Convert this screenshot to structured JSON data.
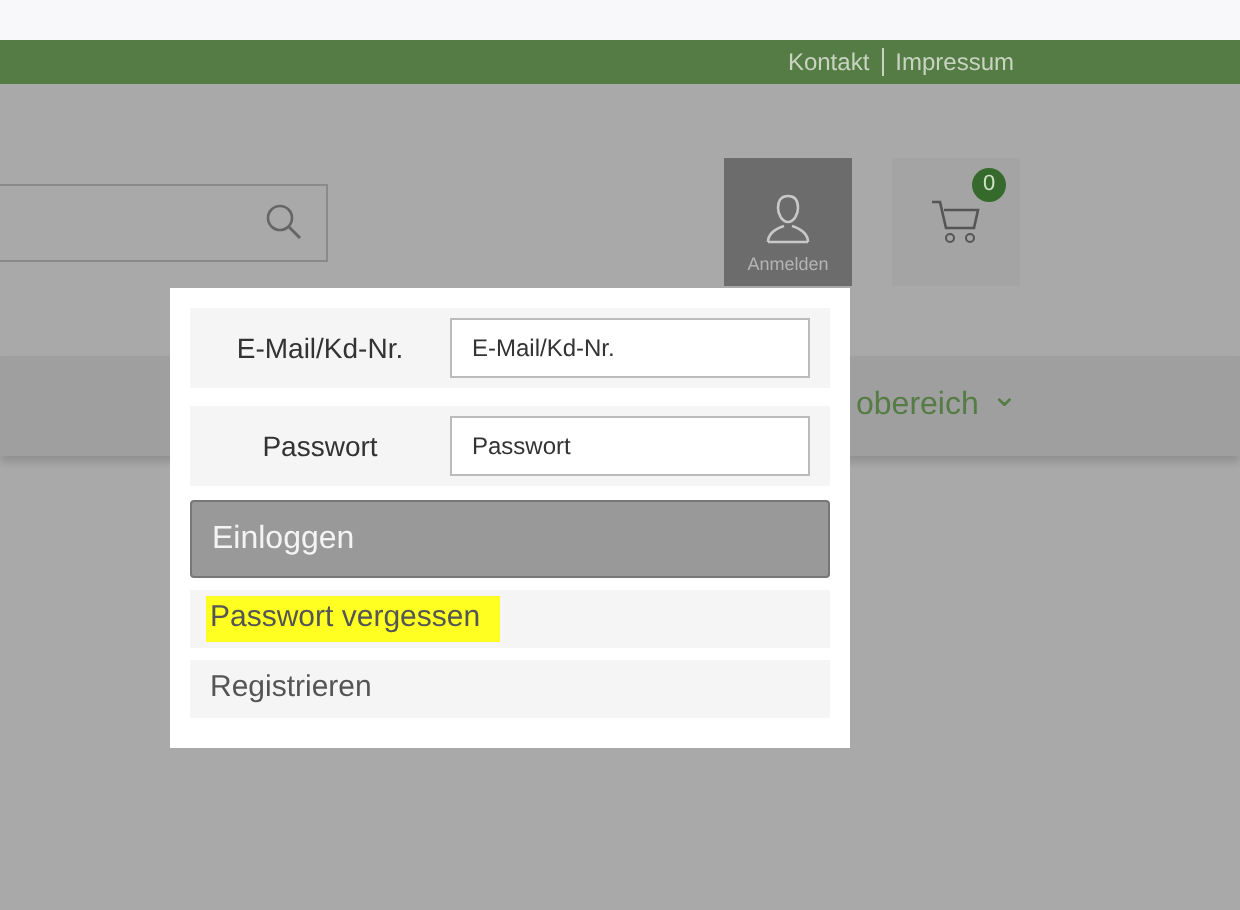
{
  "top_links": [
    "Kontakt",
    "Impressum"
  ],
  "account": {
    "label": "Anmelden",
    "active": true
  },
  "cart": {
    "count": "0"
  },
  "nav": {
    "item": "obereich",
    "chevron": "⌄"
  },
  "login": {
    "fields": [
      {
        "label": "E-Mail/Kd-Nr.",
        "placeholder": "E-Mail/Kd-Nr."
      },
      {
        "label": "Passwort",
        "placeholder": "Passwort"
      }
    ],
    "submit": "Einloggen",
    "links": [
      {
        "text": "Passwort vergessen",
        "highlighted": true
      },
      {
        "text": "Registrieren",
        "highlighted": false
      }
    ]
  }
}
